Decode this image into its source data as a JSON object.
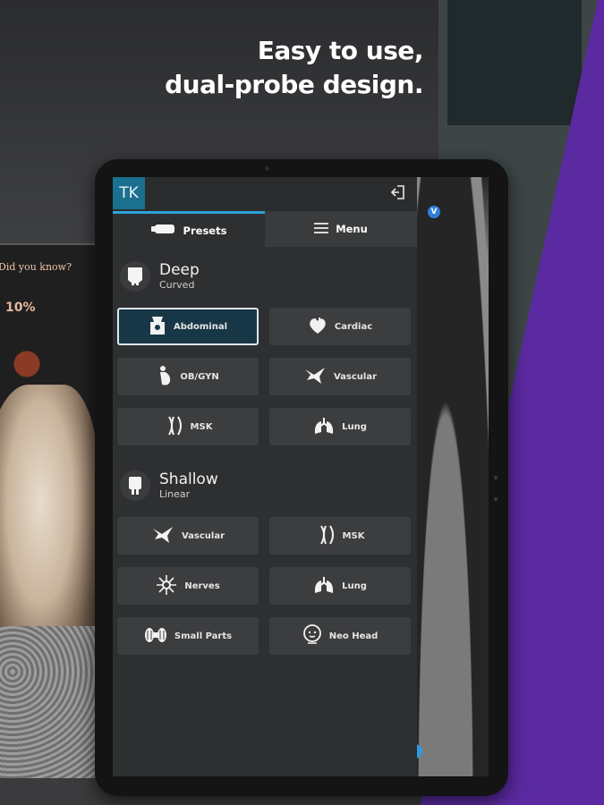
{
  "headline": {
    "line1": "Easy to use,",
    "line2": "dual-probe design."
  },
  "poster": {
    "question": "Did you know?",
    "stat": "10%"
  },
  "app": {
    "user_initials": "TK",
    "exit_icon": "exit-icon",
    "tabs": [
      {
        "label": "Presets",
        "icon": "probe-icon",
        "active": true
      },
      {
        "label": "Menu",
        "icon": "hamburger-icon",
        "active": false
      }
    ],
    "deep": {
      "title": "Deep",
      "subtitle": "Curved",
      "presets": [
        {
          "label": "Abdominal",
          "icon": "abdominal-icon",
          "selected": true
        },
        {
          "label": "Cardiac",
          "icon": "heart-icon",
          "selected": false
        },
        {
          "label": "OB/GYN",
          "icon": "ob-gyn-icon",
          "selected": false
        },
        {
          "label": "Vascular",
          "icon": "vascular-icon",
          "selected": false
        },
        {
          "label": "MSK",
          "icon": "msk-icon",
          "selected": false
        },
        {
          "label": "Lung",
          "icon": "lung-icon",
          "selected": false
        }
      ]
    },
    "shallow": {
      "title": "Shallow",
      "subtitle": "Linear",
      "presets": [
        {
          "label": "Vascular",
          "icon": "vascular-icon",
          "selected": false
        },
        {
          "label": "MSK",
          "icon": "msk-icon",
          "selected": false
        },
        {
          "label": "Nerves",
          "icon": "nerves-icon",
          "selected": false
        },
        {
          "label": "Lung",
          "icon": "lung-icon",
          "selected": false
        },
        {
          "label": "Small Parts",
          "icon": "small-parts-icon",
          "selected": false
        },
        {
          "label": "Neo Head",
          "icon": "neo-head-icon",
          "selected": false
        }
      ]
    },
    "image_badge": "V"
  },
  "colors": {
    "accent": "#2aa4d8",
    "tk_bg": "#1b6f8f",
    "selected_bg": "#173746",
    "purple": "#5b2aa0"
  }
}
